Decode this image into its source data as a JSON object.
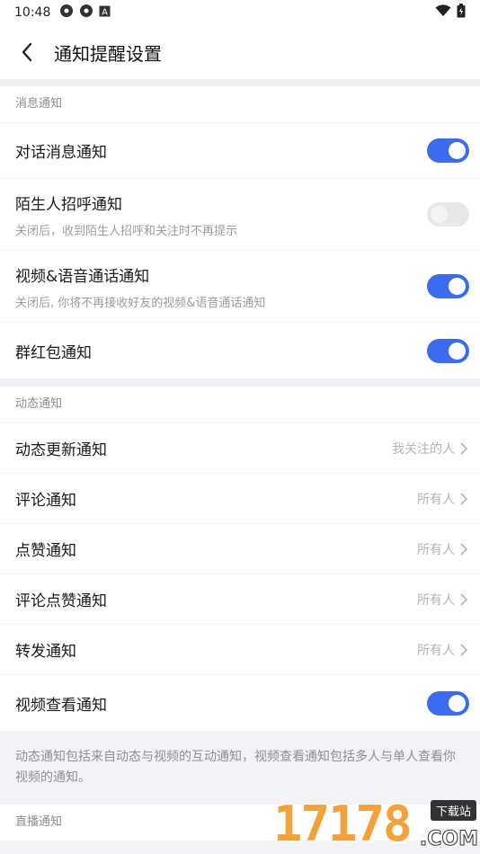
{
  "status_bar": {
    "time": "10:48",
    "icons": [
      "app-icon",
      "app-icon",
      "android-icon"
    ],
    "right_icons": [
      "wifi-icon",
      "battery-icon"
    ]
  },
  "header": {
    "title": "通知提醒设置",
    "back_icon": "back-chevron-icon"
  },
  "sections": {
    "message": {
      "label": "消息通知",
      "items": [
        {
          "label": "对话消息通知",
          "toggle": true
        },
        {
          "label": "陌生人招呼通知",
          "sub": "关闭后，收到陌生人招呼和关注时不再提示",
          "toggle": false
        },
        {
          "label": "视频&语音通话通知",
          "sub": "关闭后, 你将不再接收好友的视频&语音通话通知",
          "toggle": true
        },
        {
          "label": "群红包通知",
          "toggle": true
        }
      ]
    },
    "dynamic": {
      "label": "动态通知",
      "items": [
        {
          "label": "动态更新通知",
          "value": "我关注的人"
        },
        {
          "label": "评论通知",
          "value": "所有人"
        },
        {
          "label": "点赞通知",
          "value": "所有人"
        },
        {
          "label": "评论点赞通知",
          "value": "所有人"
        },
        {
          "label": "转发通知",
          "value": "所有人"
        },
        {
          "label": "视频查看通知",
          "toggle": true
        }
      ],
      "note": "动态通知包括来自动态与视频的互动通知，视频查看通知包括多人与单人查看你视频的通知。"
    },
    "live": {
      "label": "直播通知"
    }
  },
  "watermark": {
    "digits": "17178",
    "badge": "下载站",
    "suffix": ".COM"
  },
  "colors": {
    "accent": "#3d6bf0",
    "toggle_off": "#e7e7e9",
    "watermark": "#f3a23b"
  }
}
